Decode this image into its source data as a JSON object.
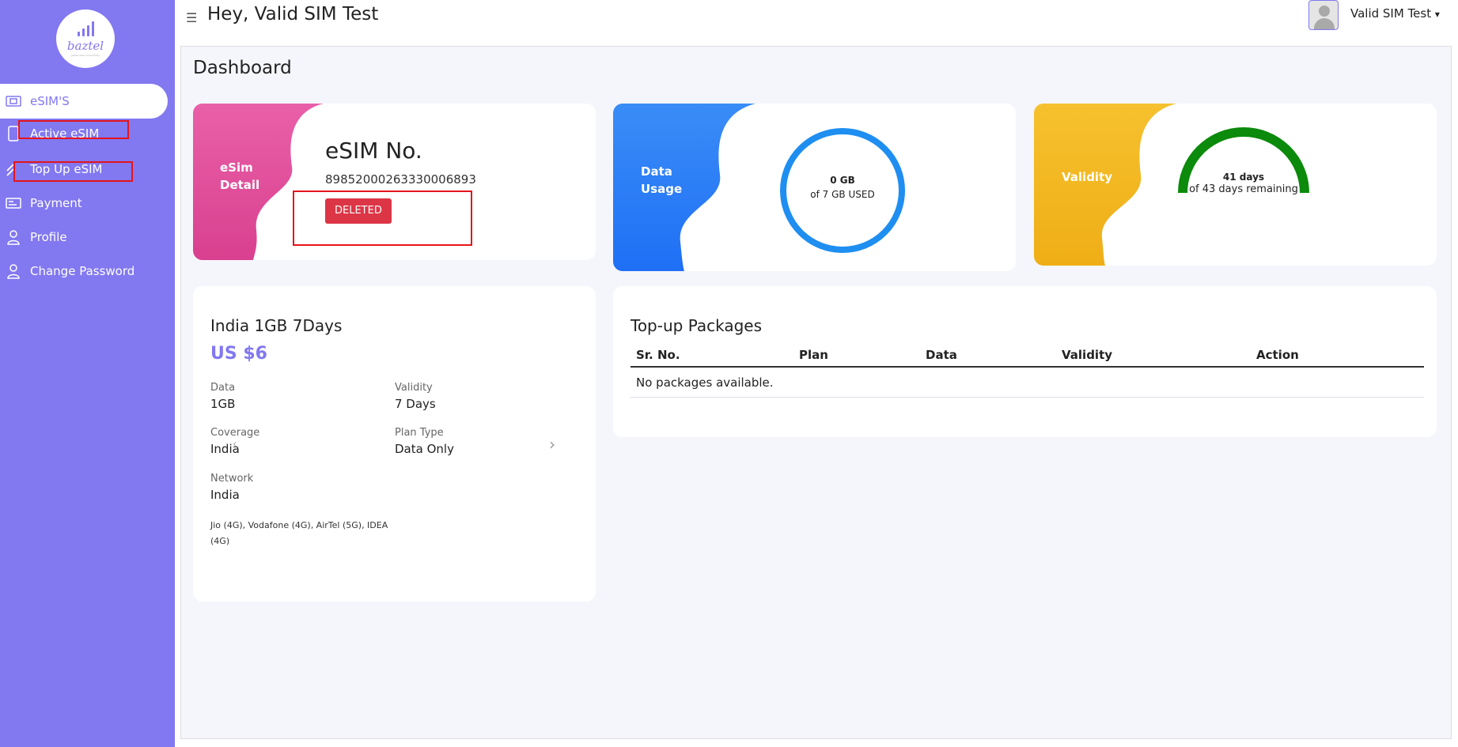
{
  "app": {
    "logo_text": "baztel",
    "logo_tagline": "global data connectivity",
    "accent_color": "#8278f0"
  },
  "sidebar": {
    "items": [
      {
        "label": "eSIM'S",
        "icon": "sim-card-icon"
      },
      {
        "label": "Active eSIM",
        "icon": "phone-icon"
      },
      {
        "label": "Top Up eSIM",
        "icon": "chevrons-up-icon"
      },
      {
        "label": "Payment",
        "icon": "credit-card-icon"
      },
      {
        "label": "Profile",
        "icon": "user-icon"
      },
      {
        "label": "Change Password",
        "icon": "user-lock-icon"
      }
    ]
  },
  "header": {
    "greeting": "Hey, Valid SIM Test",
    "user_name": "Valid SIM Test",
    "user_caret": "▾"
  },
  "page": {
    "title": "Dashboard"
  },
  "esim_card": {
    "blob_label_1": "eSim",
    "blob_label_2": "Detail",
    "title": "eSIM No.",
    "number": "89852000263330006893",
    "status": "DELETED",
    "status_color": "#dc3545"
  },
  "data_card": {
    "blob_label_1": "Data",
    "blob_label_2": "Usage",
    "used": "0 GB",
    "caption": "of 7 GB USED",
    "used_fraction": 0,
    "ring_color": "#1f8ef1"
  },
  "validity_card": {
    "blob_label": "Validity",
    "days": "41 days",
    "caption": "of 43 days remaining",
    "remaining_fraction": 0.953,
    "arc_color": "#0b8a0b"
  },
  "plan": {
    "name": "India 1GB 7Days",
    "price": "US $6",
    "data_label": "Data",
    "data_value": "1GB",
    "validity_label": "Validity",
    "validity_value": "7 Days",
    "coverage_label": "Coverage",
    "coverage_value": "India",
    "plan_type_label": "Plan Type",
    "plan_type_value": "Data Only",
    "network_label": "Network",
    "network_value": "India",
    "operators": "Jio (4G), Vodafone (4G), AirTel (5G), IDEA (4G)"
  },
  "topup": {
    "title": "Top-up Packages",
    "columns": [
      "Sr. No.",
      "Plan",
      "Data",
      "Validity",
      "Action"
    ],
    "empty_message": "No packages available."
  }
}
